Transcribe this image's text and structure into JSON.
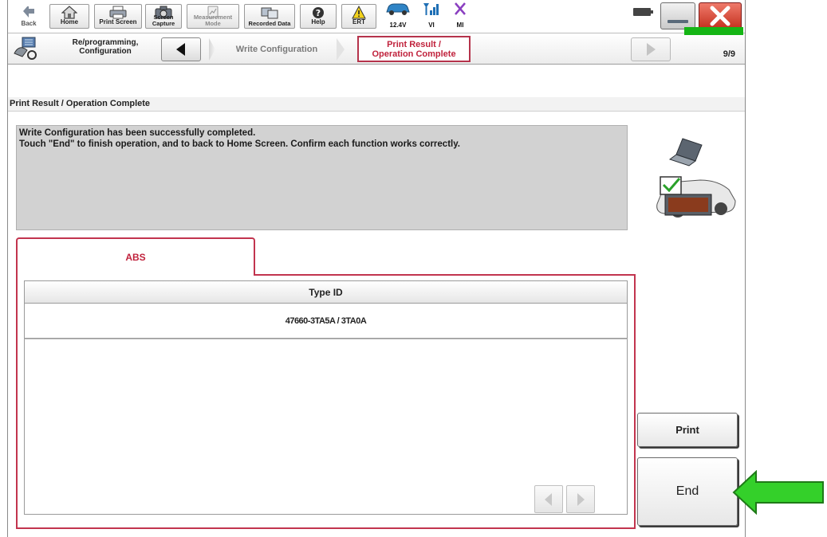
{
  "toolbar": {
    "back_label": "Back",
    "home_label": "Home",
    "print_screen_label": "Print Screen",
    "screen_capture_label": "Screen Capture",
    "measurement_mode_label": "Measurement Mode",
    "recorded_data_label": "Recorded Data",
    "help_label": "Help",
    "ert_label": "ERT",
    "voltage_label": "12.4V",
    "vi_label": "VI",
    "mi_label": "MI"
  },
  "stepbar": {
    "title": "Re/programming, Configuration",
    "previous_step": "Write Configuration",
    "current_step_line1": "Print Result /",
    "current_step_line2": "Operation Complete",
    "progress_text": "9/9",
    "progress_fraction": 1.0
  },
  "header": {
    "title": "Print Result / Operation Complete"
  },
  "message": {
    "line1": "Write Configuration has been successfully completed.",
    "line2": "Touch \"End\" to finish operation, and to back to Home Screen. Confirm each function works correctly."
  },
  "tabs": [
    {
      "label": "ABS"
    }
  ],
  "table": {
    "column_header": "Type ID",
    "rows": [
      {
        "type_id": "47660-3TA5A / 3TA0A"
      }
    ]
  },
  "buttons": {
    "print_label": "Print",
    "end_label": "End"
  },
  "colors": {
    "accent": "#c0223c",
    "progress": "#15b515",
    "callout_arrow": "#34d02a"
  }
}
